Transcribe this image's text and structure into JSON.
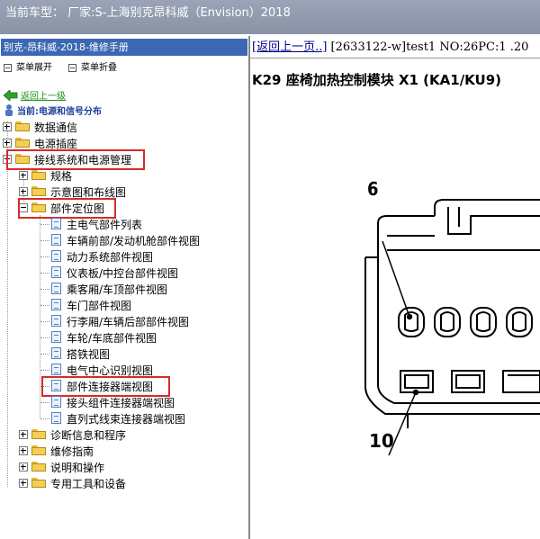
{
  "window": {
    "title": "当前车型： 厂家:S-上海别克昂科威（Envision）2018"
  },
  "sidebar": {
    "header": "别克-昂科威-2018-维修手册",
    "expand_all": "菜单展开",
    "collapse_all": "菜单折叠",
    "back": "返回上一级",
    "current": "当前:电源和信号分布",
    "items": [
      {
        "label": "数据通信"
      },
      {
        "label": "电源插座"
      },
      {
        "label": "接线系统和电源管理"
      },
      {
        "label": "规格"
      },
      {
        "label": "示意图和布线图"
      },
      {
        "label": "部件定位图"
      },
      {
        "label": "主电气部件列表"
      },
      {
        "label": "车辆前部/发动机舱部件视图"
      },
      {
        "label": "动力系统部件视图"
      },
      {
        "label": "仪表板/中控台部件视图"
      },
      {
        "label": "乘客厢/车顶部件视图"
      },
      {
        "label": "车门部件视图"
      },
      {
        "label": "行李厢/车辆后部部件视图"
      },
      {
        "label": "车轮/车底部件视图"
      },
      {
        "label": "搭铁视图"
      },
      {
        "label": "电气中心识别视图"
      },
      {
        "label": "部件连接器端视图"
      },
      {
        "label": "接头组件连接器端视图"
      },
      {
        "label": "直列式线束连接器端视图"
      },
      {
        "label": "诊断信息和程序"
      },
      {
        "label": "维修指南"
      },
      {
        "label": "说明和操作"
      },
      {
        "label": "专用工具和设备"
      }
    ]
  },
  "content": {
    "back_link": "[返回上一页..]",
    "doc_meta": " [2633122-w]test1 NO:26PC:1 .20",
    "title": "K29 座椅加热控制模块 X1 (KA1/KU9)",
    "callouts": [
      "6",
      "10"
    ]
  },
  "colors": {
    "header_blue": "#3b68b4",
    "highlight_red": "#d62a2a",
    "link_green": "#1a8f1a"
  }
}
